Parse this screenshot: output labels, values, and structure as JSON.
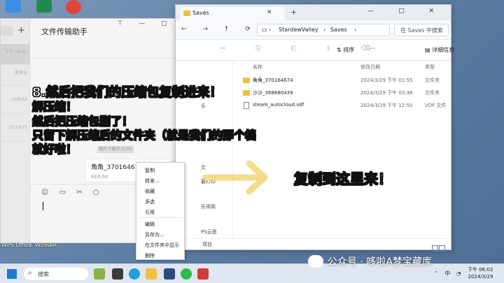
{
  "desktop": {
    "labels": [
      "WPS Office",
      "WinRAR"
    ]
  },
  "chat": {
    "title": "文件传输助手",
    "list_times": [
      "下午 06:01",
      "星期五",
      "10/5/12",
      "23/10/15"
    ],
    "bubble_watermark": "图片下载中 3.5%",
    "file_name": "角角_370164674.zip",
    "file_size": "818.6K"
  },
  "context_menu": {
    "items": [
      "复制",
      "转发...",
      "收藏",
      "多选",
      "引用",
      "编辑",
      "另存为...",
      "在文件夹中显示",
      "删除"
    ]
  },
  "explorer": {
    "tab_label": "Saves",
    "address": [
      "StardewValley",
      "Saves"
    ],
    "search_placeholder": "在 Saves 中搜索",
    "sort_label": "排序",
    "details_label": "详细信息",
    "columns": {
      "name": "名称",
      "date": "修改日期",
      "type": "类型"
    },
    "files": [
      {
        "name": "角角_370164674",
        "date": "2024/3/29 下午 01:55",
        "type": "文件夹",
        "icon": "folder-icon"
      },
      {
        "name": "沙沙_368680439",
        "date": "2024/3/29 下午 03:38",
        "type": "文件夹",
        "icon": "folder-icon"
      },
      {
        "name": "steam_autocloud.vdf",
        "date": "2024/3/29 下午 12:50",
        "type": "VDF 文件",
        "icon": "document-icon"
      }
    ],
    "nav_items": [
      "乐",
      "文",
      "要打印",
      "乐师简",
      "PS云盘"
    ],
    "status": "项目"
  },
  "captions": {
    "line1": "8.然后把我们的压缩包复制进来！",
    "line2": "解压缩！",
    "line3": "然后把压缩包删了！",
    "line4": "只留下解压缩后的文件夹（就是我们的那个档",
    "line5": "就好啦！",
    "right": "复制到这里来！"
  },
  "taskbar": {
    "search_label": "搜索",
    "time": "下午 06:02",
    "date": "2024/3/29",
    "lang": "中"
  },
  "watermark": "公众号 · 哆啦A梦宝藏库",
  "colors": {
    "arrow": "#f3dc8a",
    "folder": "#f0c040",
    "accent": "#1e78d6"
  }
}
